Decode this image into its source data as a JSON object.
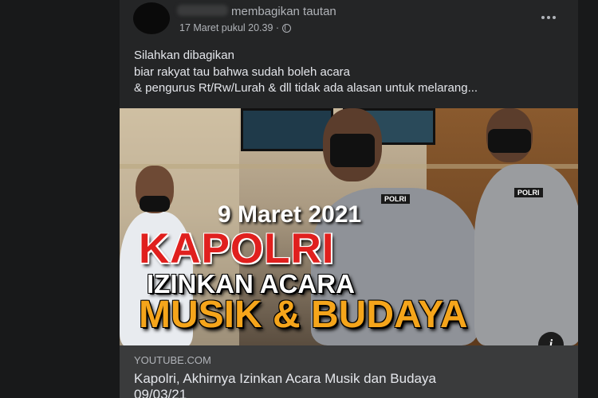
{
  "post": {
    "action_text": "membagikan tautan",
    "timestamp": "17 Maret pukul 20.39 ·",
    "privacy_icon": "globe-icon",
    "more_icon": "more-horizontal-icon",
    "body_lines": [
      "Silahkan dibagikan",
      "biar rakyat tau bahwa sudah boleh acara",
      "& pengurus Rt/Rw/Lurah & dll tidak ada alasan untuk melarang..."
    ]
  },
  "link": {
    "image": {
      "date_text": "9 Maret 2021",
      "headline_1": "KAPOLRI",
      "headline_2": "IZINKAN ACARA",
      "headline_3": "MUSIK & BUDAYA",
      "badge_left": "POLRI",
      "badge_right": "POLRI",
      "info_icon": "info-icon",
      "info_glyph": "i"
    },
    "domain": "YOUTUBE.COM",
    "title_lines": [
      "Kapolri, Akhirnya Izinkan Acara Musik dan Budaya",
      "09/03/21"
    ]
  },
  "colors": {
    "background": "#18191a",
    "card": "#242526",
    "preview": "#3a3b3c",
    "headline_red": "#e0201e",
    "headline_orange": "#f5a51b"
  }
}
